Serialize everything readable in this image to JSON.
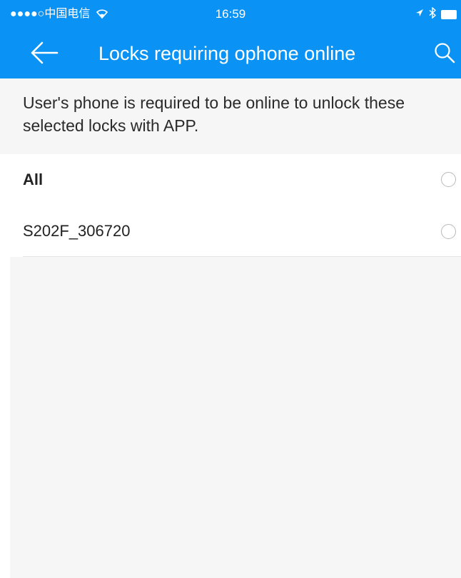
{
  "status_bar": {
    "signal": "●●●●○",
    "carrier": "中国电信",
    "wifi_icon": "wifi-icon",
    "time": "16:59",
    "location_icon": "location-arrow-icon",
    "bluetooth_icon": "bluetooth-icon",
    "battery_icon": "battery-icon"
  },
  "header": {
    "title": "Locks requiring ophone online",
    "back_icon": "back-arrow-icon",
    "search_icon": "search-icon",
    "background_color": "#0a93f5"
  },
  "description": "User's phone is required to be online to unlock these selected locks with APP.",
  "locks": [
    {
      "label": "All",
      "selected": false
    },
    {
      "label": "S202F_306720",
      "selected": false
    }
  ],
  "colors": {
    "accent": "#0a93f5",
    "page_background": "#f6f6f6",
    "radio_border": "#b8b8b8"
  }
}
